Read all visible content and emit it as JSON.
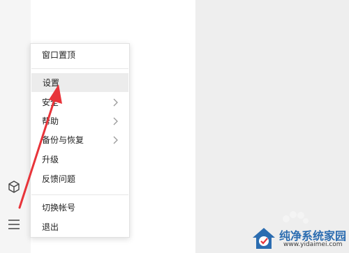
{
  "menu": {
    "items": [
      {
        "label": "窗口置顶"
      },
      {
        "label": "设置"
      },
      {
        "label": "安全"
      },
      {
        "label": "帮助"
      },
      {
        "label": "备份与恢复"
      },
      {
        "label": "升级"
      },
      {
        "label": "反馈问题"
      },
      {
        "label": "切换帐号"
      },
      {
        "label": "退出"
      }
    ]
  },
  "sidebar": {
    "icons": [
      "cube-icon",
      "hamburger-menu-icon"
    ]
  },
  "watermark": {
    "title": "纯净系统家园",
    "url": "www.yidaimei.com"
  },
  "colors": {
    "highlight": "#ececec",
    "arrow": "#e8343a",
    "right_pane": "#eeeeee",
    "watermark_blue": "#2b6cb0"
  }
}
